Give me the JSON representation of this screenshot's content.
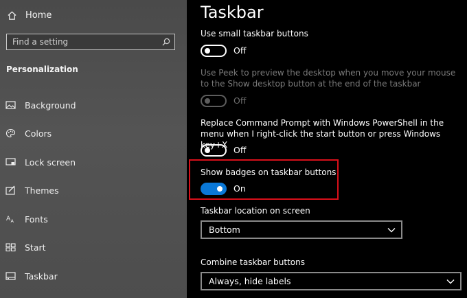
{
  "sidebar": {
    "home_label": "Home",
    "search_placeholder": "Find a setting",
    "section_title": "Personalization",
    "items": [
      {
        "label": "Background",
        "icon": "picture-icon"
      },
      {
        "label": "Colors",
        "icon": "palette-icon"
      },
      {
        "label": "Lock screen",
        "icon": "lock-screen-icon"
      },
      {
        "label": "Themes",
        "icon": "themes-icon"
      },
      {
        "label": "Fonts",
        "icon": "fonts-icon"
      },
      {
        "label": "Start",
        "icon": "start-icon"
      },
      {
        "label": "Taskbar",
        "icon": "taskbar-icon"
      }
    ]
  },
  "main": {
    "title": "Taskbar",
    "settings": [
      {
        "label": "Use small taskbar buttons",
        "state": "Off",
        "on": false,
        "enabled": true
      },
      {
        "label": "Use Peek to preview the desktop when you move your mouse to the Show desktop button at the end of the taskbar",
        "state": "Off",
        "on": false,
        "enabled": false
      },
      {
        "label": "Replace Command Prompt with Windows PowerShell in the menu when I right-click the start button or press Windows key+X",
        "state": "Off",
        "on": false,
        "enabled": true
      },
      {
        "label": "Show badges on taskbar buttons",
        "state": "On",
        "on": true,
        "enabled": true
      }
    ],
    "location": {
      "label": "Taskbar location on screen",
      "value": "Bottom"
    },
    "combine": {
      "label": "Combine taskbar buttons",
      "value": "Always, hide labels"
    }
  },
  "colors": {
    "accent": "#0a78d7",
    "highlight_border": "#d9101a",
    "sidebar_bg": "#4f4f4f",
    "main_bg": "#000000"
  }
}
